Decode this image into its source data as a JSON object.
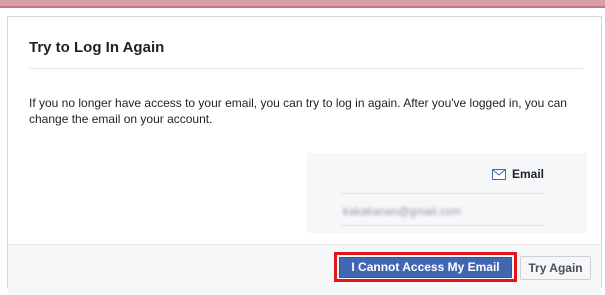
{
  "dialog": {
    "title": "Try to Log In Again",
    "body": "If you no longer have access to your email, you can try to log in again. After you've logged in, you can change the email on your account.",
    "email_panel": {
      "label": "Email",
      "icon": "mail-icon",
      "masked_value": "kakakanan@gmail.com"
    },
    "footer": {
      "primary_button": "I Cannot Access My Email",
      "secondary_button": "Try Again"
    }
  },
  "colors": {
    "primary_button": "#4267b2",
    "highlight_box": "#e0161e",
    "footer_bg": "#f6f7f9",
    "top_bar": "#d8a0a6"
  }
}
